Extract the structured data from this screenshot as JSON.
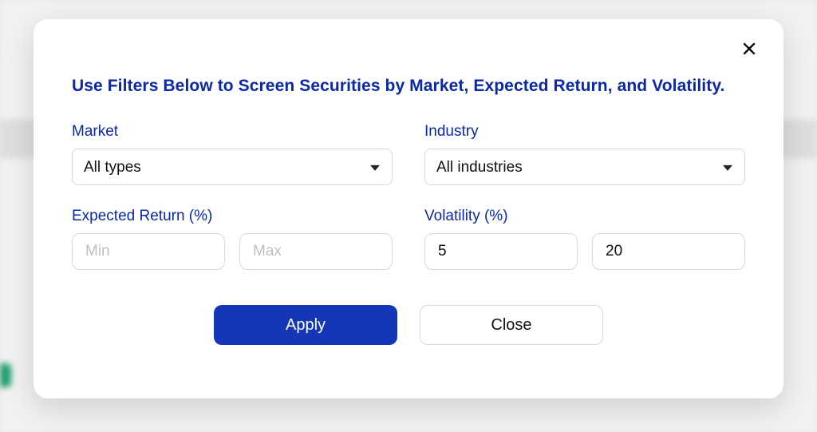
{
  "modal": {
    "title": "Use Filters Below to Screen Securities by Market, Expected Return, and Volatility.",
    "fields": {
      "market": {
        "label": "Market",
        "selected": "All types"
      },
      "industry": {
        "label": "Industry",
        "selected": "All industries"
      },
      "expected_return": {
        "label": "Expected Return (%)",
        "min_placeholder": "Min",
        "max_placeholder": "Max",
        "min_value": "",
        "max_value": ""
      },
      "volatility": {
        "label": "Volatility (%)",
        "min_value": "5",
        "max_value": "20"
      }
    },
    "buttons": {
      "apply": "Apply",
      "close": "Close"
    }
  }
}
